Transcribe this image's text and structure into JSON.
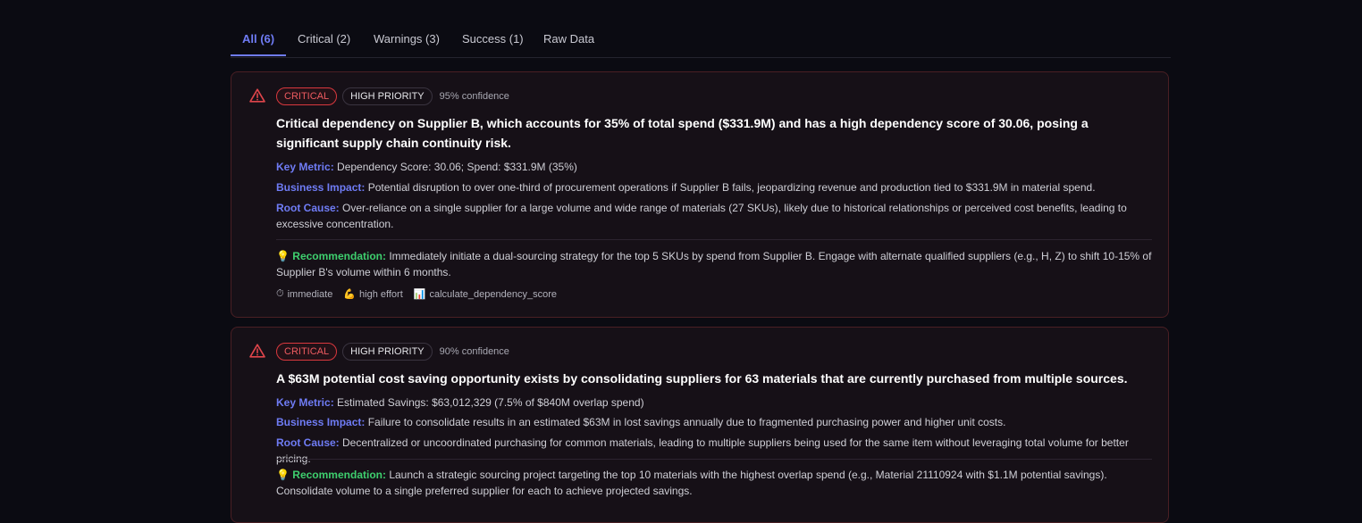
{
  "tabs": [
    {
      "label": "All (6)",
      "active": true
    },
    {
      "label": "Critical (2)",
      "active": false
    },
    {
      "label": "Warnings (3)",
      "active": false
    },
    {
      "label": "Success (1)",
      "active": false
    },
    {
      "label": "Raw Data",
      "active": false
    }
  ],
  "labels": {
    "key_metric": "Key Metric:",
    "business_impact": "Business Impact:",
    "root_cause": "Root Cause:",
    "recommendation": "Recommendation:"
  },
  "icons": {
    "warning": "warning-triangle-icon",
    "bulb": "💡",
    "timer": "⏱",
    "effort": "💪",
    "chart": "📊"
  },
  "colors": {
    "accent": "#6f7cf5",
    "critical": "#ee5b60",
    "success": "#3ecf6e",
    "card_border": "#4a1f24"
  },
  "insights": [
    {
      "severity": "CRITICAL",
      "priority": "HIGH PRIORITY",
      "confidence": "95% confidence",
      "title": "Critical dependency on Supplier B, which accounts for 35% of total spend ($331.9M) and has a high dependency score of 30.06, posing a significant supply chain continuity risk.",
      "key_metric": "Dependency Score: 30.06; Spend: $331.9M (35%)",
      "business_impact": "Potential disruption to over one-third of procurement operations if Supplier B fails, jeopardizing revenue and production tied to $331.9M in material spend.",
      "root_cause": "Over-reliance on a single supplier for a large volume and wide range of materials (27 SKUs), likely due to historical relationships or perceived cost benefits, leading to excessive concentration.",
      "recommendation": "Immediately initiate a dual-sourcing strategy for the top 5 SKUs by spend from Supplier B. Engage with alternate qualified suppliers (e.g., H, Z) to shift 10-15% of Supplier B's volume within 6 months.",
      "timing": "immediate",
      "effort": "high effort",
      "tool": "calculate_dependency_score"
    },
    {
      "severity": "CRITICAL",
      "priority": "HIGH PRIORITY",
      "confidence": "90% confidence",
      "title": "A $63M potential cost saving opportunity exists by consolidating suppliers for 63 materials that are currently purchased from multiple sources.",
      "key_metric": "Estimated Savings: $63,012,329 (7.5% of $840M overlap spend)",
      "business_impact": "Failure to consolidate results in an estimated $63M in lost savings annually due to fragmented purchasing power and higher unit costs.",
      "root_cause": "Decentralized or uncoordinated purchasing for common materials, leading to multiple suppliers being used for the same item without leveraging total volume for better pricing.",
      "recommendation": "Launch a strategic sourcing project targeting the top 10 materials with the highest overlap spend (e.g., Material 21110924 with $1.1M potential savings). Consolidate volume to a single preferred supplier for each to achieve projected savings."
    }
  ]
}
